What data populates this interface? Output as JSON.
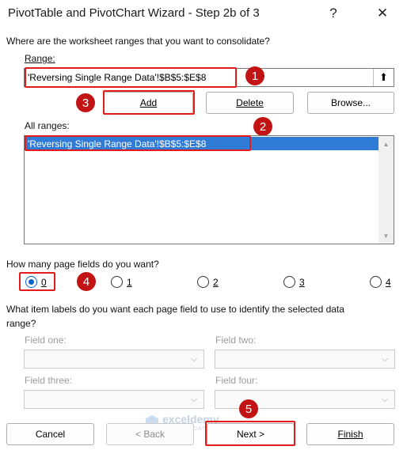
{
  "window": {
    "title": "PivotTable and PivotChart Wizard - Step 2b of 3",
    "help_icon": "?",
    "close_icon": "✕"
  },
  "prompt": "Where are the worksheet ranges that you want to consolidate?",
  "range": {
    "label": "Range:",
    "value": "'Reversing Single Range Data'!$B$5:$E$8",
    "collapse_icon": "⬆"
  },
  "buttons": {
    "add": "Add",
    "delete": "Delete",
    "browse": "Browse..."
  },
  "all_ranges": {
    "label": "All ranges:",
    "items": [
      "'Reversing Single Range Data'!$B$5:$E$8"
    ],
    "up_arrow": "▲",
    "down_arrow": "▼"
  },
  "page_fields": {
    "question": "How many page fields do you want?",
    "options": [
      "0",
      "1",
      "2",
      "3",
      "4"
    ],
    "selected": "0"
  },
  "item_labels": {
    "question_line1": "What item labels do you want each page field to use to identify the selected data",
    "question_line2": "range?"
  },
  "fields": {
    "one": "Field one:",
    "two": "Field two:",
    "three": "Field three:",
    "four": "Field four:"
  },
  "footer": {
    "cancel": "Cancel",
    "back": "< Back",
    "next": "Next >",
    "finish": "Finish"
  },
  "annotations": [
    "1",
    "2",
    "3",
    "4",
    "5"
  ],
  "watermark": {
    "brand": "exceldemy",
    "tagline": "EXCEL · DATA · BI"
  },
  "colors": {
    "accent": "#0a63c5",
    "highlight": "#2f7bd6",
    "annotation": "#c21414",
    "annotation_border": "#e41b1b"
  }
}
